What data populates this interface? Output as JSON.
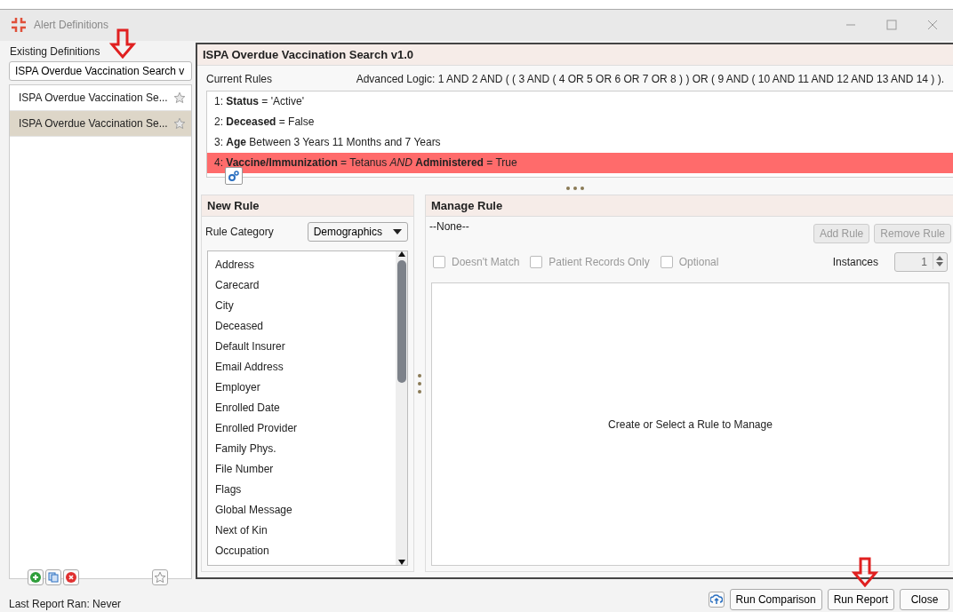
{
  "window": {
    "title": "Alert Definitions"
  },
  "sidebar": {
    "label": "Existing Definitions",
    "search_value": "ISPA Overdue Vaccination Search v",
    "items": [
      {
        "label": "ISPA Overdue Vaccination Se...",
        "selected": false
      },
      {
        "label": "ISPA Overdue Vaccination Se...",
        "selected": true
      }
    ]
  },
  "definition": {
    "title": "ISPA Overdue Vaccination Search v1.0",
    "current_rules_label": "Current Rules",
    "advanced_logic": "Advanced Logic: 1 AND 2 AND ( ( 3 AND ( 4 OR 5 OR 6 OR 7 OR 8 ) ) OR ( 9 AND ( 10 AND 11 AND 12 AND 13 AND 14 ) ).",
    "rules": [
      {
        "text": "1: **Status** = 'Active'",
        "selected": false
      },
      {
        "text": "2: **Deceased** = False",
        "selected": false
      },
      {
        "text": "3: **Age** Between 3 Years 11 Months and 7 Years",
        "selected": false
      },
      {
        "text": "4: **Vaccine/Immunization** = Tetanus *AND* **Administered** = True",
        "selected": true
      }
    ]
  },
  "new_rule": {
    "title": "New Rule",
    "category_label": "Rule Category",
    "category_value": "Demographics",
    "fields": [
      "Address",
      "Carecard",
      "City",
      "Deceased",
      "Default Insurer",
      "Email Address",
      "Employer",
      "Enrolled Date",
      "Enrolled Provider",
      "Family Phys.",
      "File Number",
      "Flags",
      "Global Message",
      "Next of Kin",
      "Occupation"
    ]
  },
  "manage_rule": {
    "title": "Manage Rule",
    "selection": "--None--",
    "buttons": [
      {
        "label": "Add Rule",
        "disabled": true
      },
      {
        "label": "Remove Rule",
        "disabled": true
      }
    ],
    "options": [
      {
        "label": "Doesn't Match",
        "checked": false,
        "disabled": true
      },
      {
        "label": "Patient Records Only",
        "checked": false,
        "disabled": true
      },
      {
        "label": "Optional",
        "checked": false,
        "disabled": true
      }
    ],
    "instances_label": "Instances",
    "instances_value": "1",
    "message": "Create or Select a Rule to Manage"
  },
  "status": {
    "last_report": "Last Report Ran: Never"
  },
  "footer_buttons": [
    {
      "label": "Run Comparison"
    },
    {
      "label": "Run Report"
    },
    {
      "label": "Close"
    }
  ]
}
